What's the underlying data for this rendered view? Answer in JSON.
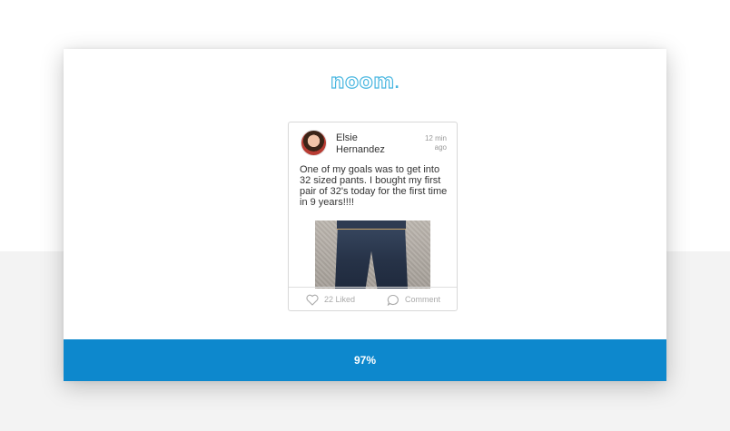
{
  "brand": {
    "logo_text": "noom",
    "accent": "#47b6e0"
  },
  "post": {
    "author_first": "Elsie",
    "author_last": "Hernandez",
    "time_value": "12 min",
    "time_unit": "ago",
    "text": "One of my goals was to get into 32 sized pants. I bought my first pair of 32's today for the first time in 9 years!!!!",
    "image_icon": "jeans-photo",
    "likes_label": "22 Liked",
    "comment_label": "Comment",
    "like_icon": "heart-icon",
    "comment_icon": "comment-icon"
  },
  "progress": {
    "label": "97%",
    "value": 0.97,
    "color": "#0d88cd"
  }
}
